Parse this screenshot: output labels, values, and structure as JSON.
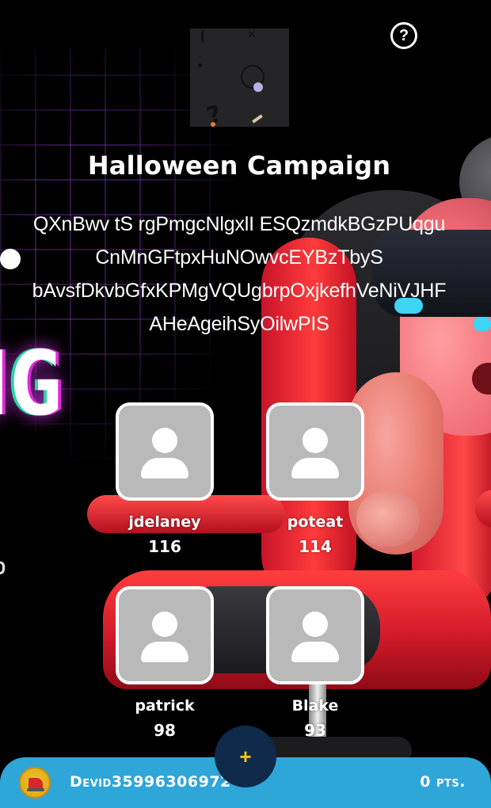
{
  "campaign": {
    "title": "Halloween Campaign",
    "description_lines": [
      "QXnBwv tS rgPmgcNlgxlI ESQzmdkBGzPUqgu",
      "CnMnGFtpxHuNOwvcEYBzTbyS",
      "bAvsfDkvbGfxKPMgVQUgbrpOxjkefhVeNiVJHF",
      "AHeAgeihSyOilwPIS"
    ],
    "background_text": "NG",
    "background_small_text": "D"
  },
  "header": {
    "help_icon": "?"
  },
  "leaderboard": [
    {
      "name": "jdelaney",
      "score": "116"
    },
    {
      "name": "poteat",
      "score": "114"
    },
    {
      "name": "patrick",
      "score": "98"
    },
    {
      "name": "Blake",
      "score": "93"
    }
  ],
  "bottom_bar": {
    "username": "Devid35996306972",
    "points": "0 pts.",
    "add_icon": "+"
  },
  "colors": {
    "bottom_bar": "#2ea6d8",
    "add_button": "#0f2a4a",
    "add_icon": "#f3c21a",
    "avatar_placeholder": "#b9b9b9"
  }
}
